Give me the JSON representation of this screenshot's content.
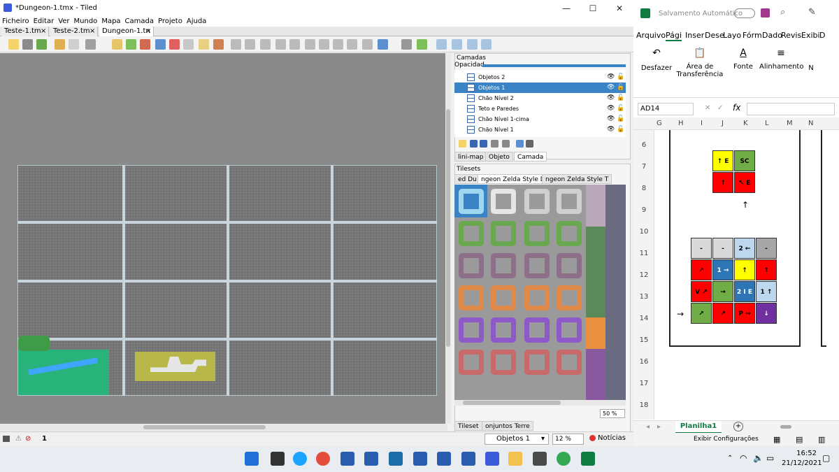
{
  "tiled": {
    "title": "*Dungeon-1.tmx - Tiled",
    "menu": [
      "Ficheiro",
      "Editar",
      "Ver",
      "Mundo",
      "Mapa",
      "Camada",
      "Projeto",
      "Ajuda"
    ],
    "tabs": [
      {
        "label": "Teste-1.tm",
        "close": "×"
      },
      {
        "label": "Teste-2.tm",
        "close": "×"
      },
      {
        "label": "Dungeon-1.tn",
        "close": "×"
      }
    ],
    "layers_panel": {
      "title": "Camadas",
      "opacity_label": "Opacidad",
      "layers": [
        {
          "name": "Objetos 2",
          "selected": false
        },
        {
          "name": "Objetos 1",
          "selected": true
        },
        {
          "name": "Chão Nível 2",
          "selected": false
        },
        {
          "name": "Teto e Paredes",
          "selected": false
        },
        {
          "name": "Chão Nível 1-cima",
          "selected": false
        },
        {
          "name": "Chão Nível 1",
          "selected": false
        }
      ],
      "subtabs": [
        "lini-map",
        "Objeto",
        "Camada"
      ]
    },
    "tilesets_panel": {
      "title": "Tilesets",
      "tabs": [
        "ed Du",
        "ngeon Zelda Style Do",
        "ngeon Zelda Style T"
      ],
      "zoom": "50 %",
      "bottom_tabs": [
        "Tileset",
        "onjuntos Terre"
      ]
    },
    "status": {
      "counter": "1",
      "layer_select": "Objetos 1",
      "zoom": "12 %",
      "news": "Notícias"
    }
  },
  "excel": {
    "autosave_label": "Salvamento Automático",
    "ribbon_tabs": [
      "Arquivo",
      "Pági",
      "Inser",
      "Dese",
      "Layo",
      "Fórm",
      "Dado",
      "Revis",
      "Exibi",
      "D"
    ],
    "ribbon_groups": [
      {
        "label": "Desfazer"
      },
      {
        "label": "Área de Transferência"
      },
      {
        "label": "Fonte"
      },
      {
        "label": "Alinhamento"
      },
      {
        "label": "N"
      }
    ],
    "name_box": "AD14",
    "fx": "fx",
    "columns": [
      "G",
      "H",
      "I",
      "J",
      "K",
      "L",
      "M",
      "N"
    ],
    "rows": [
      "6",
      "7",
      "8",
      "9",
      "10",
      "11",
      "12",
      "13",
      "14",
      "15",
      "16",
      "17",
      "18"
    ],
    "grid_top": [
      {
        "text": "↑ E",
        "color": "#ffff00"
      },
      {
        "text": "SC",
        "color": "#70ad47"
      },
      {
        "text": "↑",
        "color": "#ff0000"
      },
      {
        "text": "↖ E",
        "color": "#ff0000"
      }
    ],
    "arrow_mid": "↑",
    "grid_main": [
      {
        "text": "-",
        "color": "#d9d9d9"
      },
      {
        "text": "-",
        "color": "#d9d9d9"
      },
      {
        "text": "2 ←",
        "color": "#bdd7ee"
      },
      {
        "text": "-",
        "color": "#a6a6a6"
      },
      {
        "text": "↗",
        "color": "#ff0000"
      },
      {
        "text": "1 →",
        "color": "#2e75b6"
      },
      {
        "text": "↑",
        "color": "#ffff00"
      },
      {
        "text": "↑",
        "color": "#ff0000"
      },
      {
        "text": "V ↗",
        "color": "#ff0000"
      },
      {
        "text": "→",
        "color": "#70ad47"
      },
      {
        "text": "2 I E",
        "color": "#2e75b6"
      },
      {
        "text": "1 ↑",
        "color": "#bdd7ee"
      },
      {
        "text": "↗",
        "color": "#70ad47"
      },
      {
        "text": "↗",
        "color": "#ff0000"
      },
      {
        "text": "P →",
        "color": "#ff0000"
      },
      {
        "text": "↓",
        "color": "#7030a0"
      }
    ],
    "arrow_left": "→",
    "sheet_name": "Planilha1",
    "status_text": "Exibir Configurações"
  },
  "taskbar": {
    "time": "16:52",
    "date": "21/12/2021"
  }
}
